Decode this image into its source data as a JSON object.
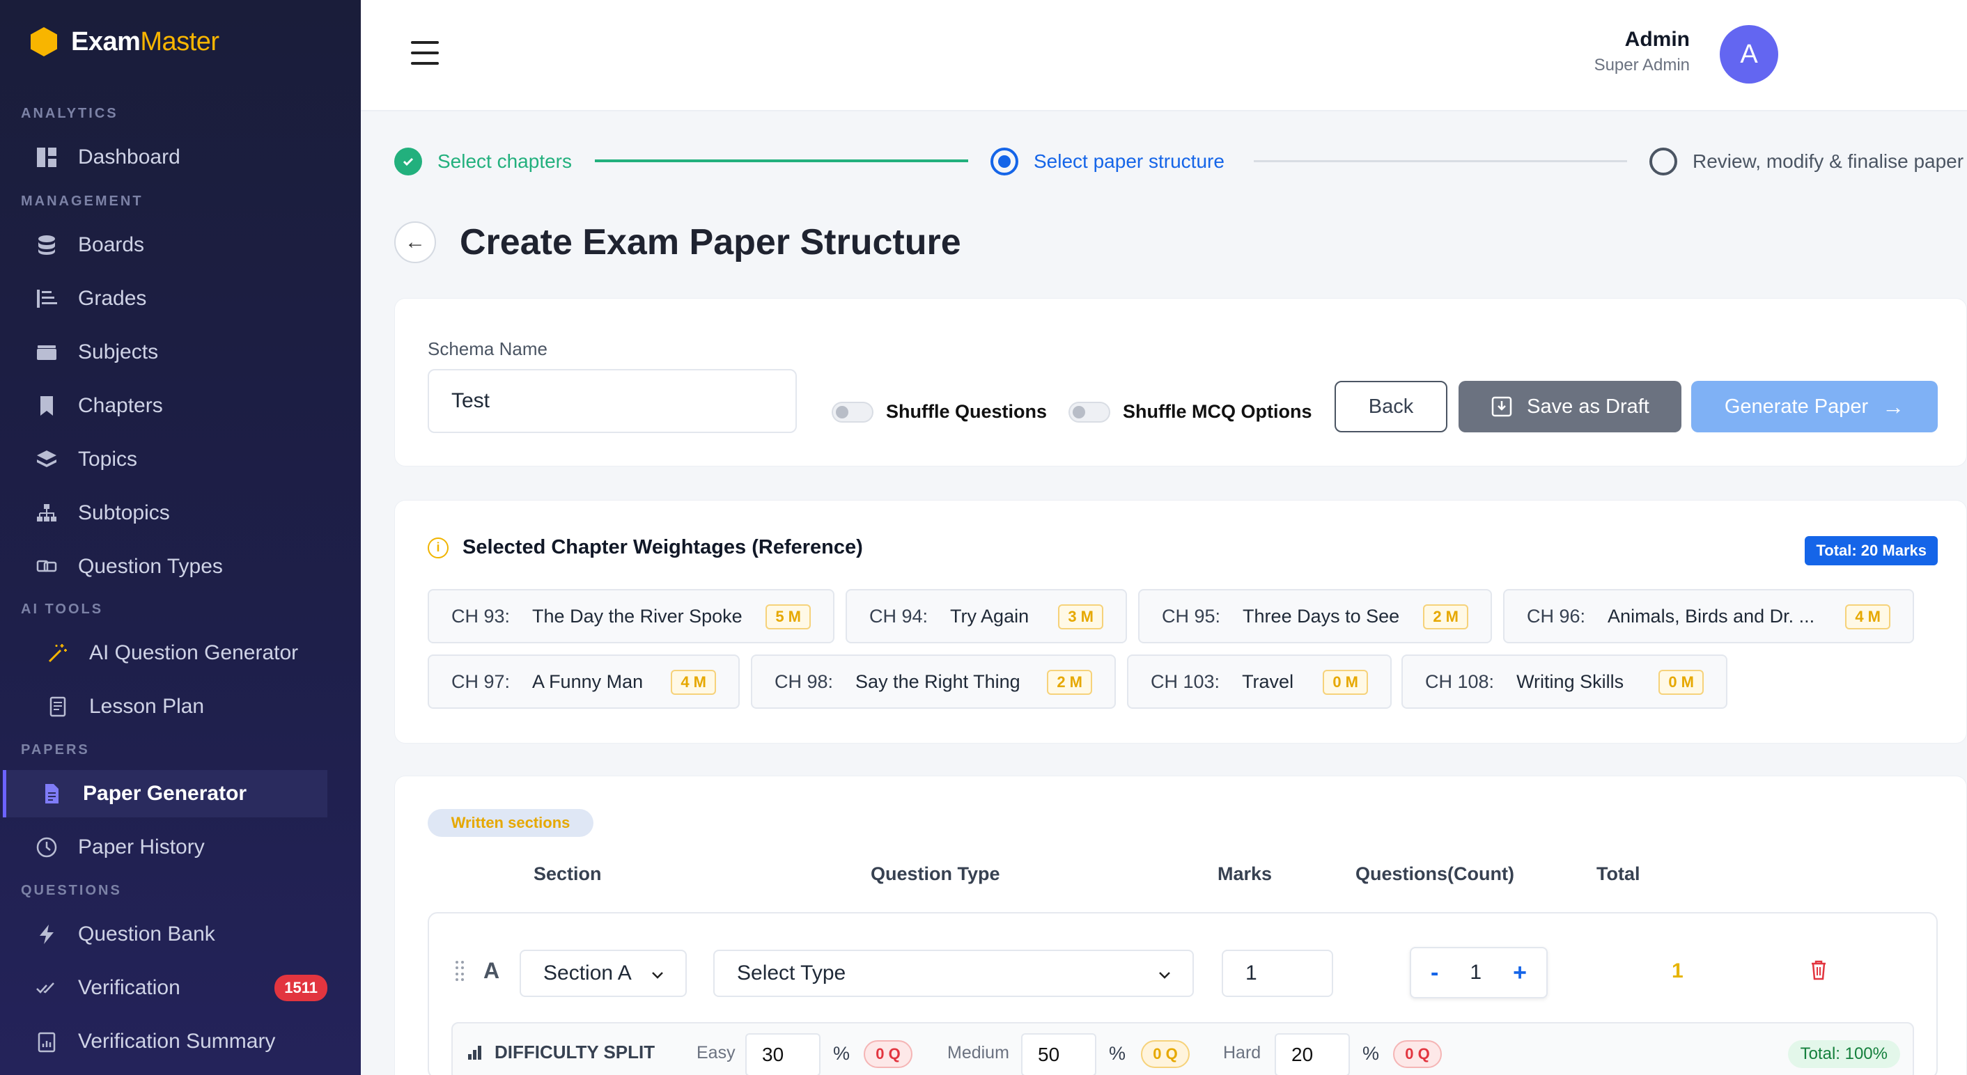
{
  "brand": {
    "name_main": "Exam",
    "name_accent": "Master"
  },
  "sidebar": {
    "sections": {
      "analytics": "ANALYTICS",
      "management": "MANAGEMENT",
      "ai_tools": "AI TOOLS",
      "papers": "PAPERS",
      "questions": "QUESTIONS"
    },
    "items": {
      "dashboard": "Dashboard",
      "boards": "Boards",
      "grades": "Grades",
      "subjects": "Subjects",
      "chapters": "Chapters",
      "topics": "Topics",
      "subtopics": "Subtopics",
      "question_types": "Question Types",
      "ai_question_generator": "AI Question Generator",
      "lesson_plan": "Lesson Plan",
      "paper_generator": "Paper Generator",
      "paper_history": "Paper History",
      "question_bank": "Question Bank",
      "verification": "Verification",
      "verification_summary": "Verification Summary"
    },
    "verification_badge": "1511"
  },
  "header": {
    "user_name": "Admin",
    "user_role": "Super Admin",
    "avatar_letter": "A"
  },
  "stepper": {
    "step1": "Select chapters",
    "step2": "Select paper structure",
    "step3": "Review, modify & finalise paper"
  },
  "page": {
    "title": "Create Exam Paper Structure"
  },
  "schema": {
    "label": "Schema Name",
    "value": "Test",
    "shuffle_questions": "Shuffle Questions",
    "shuffle_mcq": "Shuffle MCQ Options",
    "back": "Back",
    "save_draft": "Save as Draft",
    "generate": "Generate Paper"
  },
  "weightage": {
    "title": "Selected Chapter Weightages (Reference)",
    "total": "Total: 20 Marks",
    "chapters": [
      {
        "code": "CH 93:",
        "name": "The Day the River Spoke",
        "marks": "5 M"
      },
      {
        "code": "CH 94:",
        "name": "Try Again",
        "marks": "3 M"
      },
      {
        "code": "CH 95:",
        "name": "Three Days to See",
        "marks": "2 M"
      },
      {
        "code": "CH 96:",
        "name": "Animals, Birds and Dr. ...",
        "marks": "4 M"
      },
      {
        "code": "CH 97:",
        "name": "A Funny Man",
        "marks": "4 M"
      },
      {
        "code": "CH 98:",
        "name": "Say the Right Thing",
        "marks": "2 M"
      },
      {
        "code": "CH 103:",
        "name": "Travel",
        "marks": "0 M"
      },
      {
        "code": "CH 108:",
        "name": "Writing Skills",
        "marks": "0 M"
      }
    ]
  },
  "sections": {
    "pill": "Written sections",
    "headers": {
      "section": "Section",
      "question_type": "Question Type",
      "marks": "Marks",
      "count": "Questions(Count)",
      "total": "Total"
    },
    "row": {
      "letter": "A",
      "section_select": "Section A",
      "type_select": "Select Type",
      "marks": "1",
      "count": "1",
      "minus": "-",
      "plus": "+",
      "total": "1"
    },
    "difficulty": {
      "title": "DIFFICULTY SPLIT",
      "easy_label": "Easy",
      "easy_value": "30",
      "medium_label": "Medium",
      "medium_value": "50",
      "hard_label": "Hard",
      "hard_value": "20",
      "percent": "%",
      "easy_q": "0 Q",
      "medium_q": "0 Q",
      "hard_q": "0 Q",
      "total": "Total: 100%"
    }
  },
  "colors": {
    "accent_blue": "#1565e8",
    "success": "#22b07d",
    "warning": "#e6a800",
    "sidebar_bg": "#1e1f4a"
  }
}
